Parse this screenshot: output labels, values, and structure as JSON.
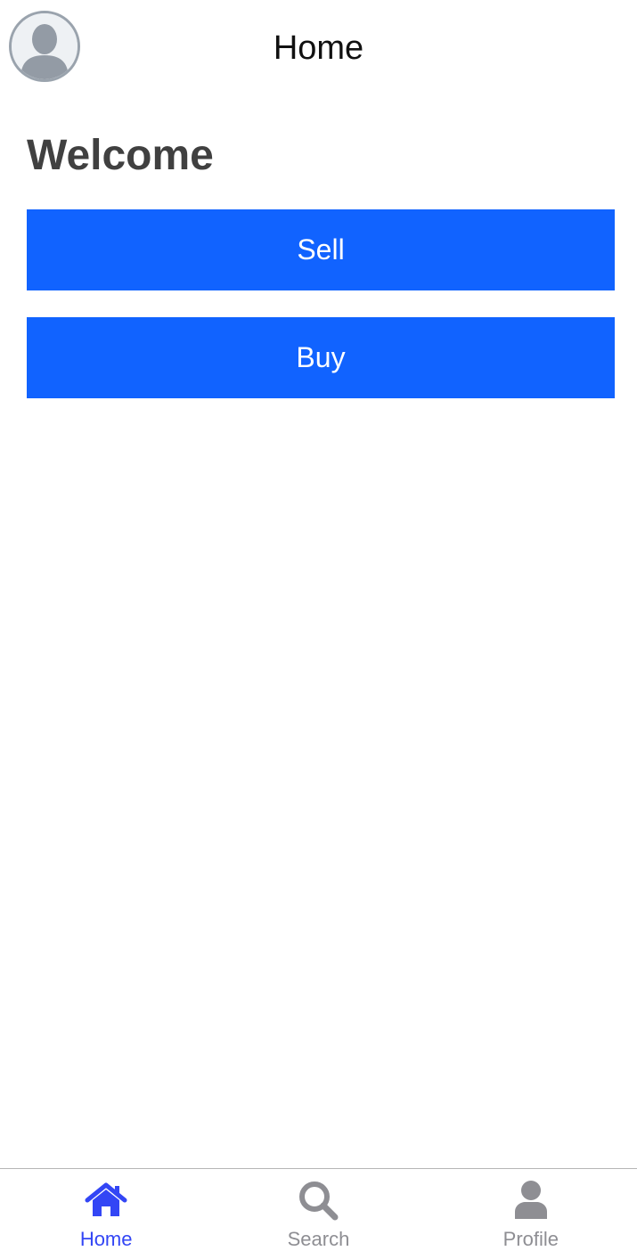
{
  "header": {
    "title": "Home",
    "avatar_icon": "person-silhouette-icon"
  },
  "main": {
    "welcome": "Welcome",
    "sell_label": "Sell",
    "buy_label": "Buy"
  },
  "tabbar": {
    "tabs": [
      {
        "label": "Home",
        "icon": "home-icon",
        "active": true
      },
      {
        "label": "Search",
        "icon": "search-icon",
        "active": false
      },
      {
        "label": "Profile",
        "icon": "person-icon",
        "active": false
      }
    ]
  },
  "colors": {
    "primary_button": "#1163ff",
    "active_tab": "#3346f5",
    "inactive_tab": "#8e8e93",
    "welcome_text": "#404040"
  }
}
